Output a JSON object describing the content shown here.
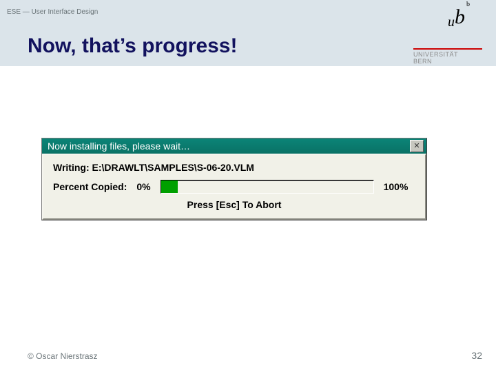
{
  "header": {
    "breadcrumb": "ESE — User Interface Design",
    "title": "Now, that’s progress!"
  },
  "logo": {
    "university_line1": "UNIVERSITÄT",
    "university_line2": "BERN"
  },
  "dialog": {
    "titlebar": "Now installing files, please wait…",
    "writing": "Writing: E:\\DRAWLT\\SAMPLES\\S-06-20.VLM",
    "percent_label": "Percent Copied:",
    "pct_start": "0%",
    "pct_end": "100%",
    "abort_hint": "Press [Esc] To Abort",
    "close_glyph": "✕"
  },
  "footer": {
    "copyright": "© Oscar Nierstrasz",
    "pagenum": "32"
  }
}
